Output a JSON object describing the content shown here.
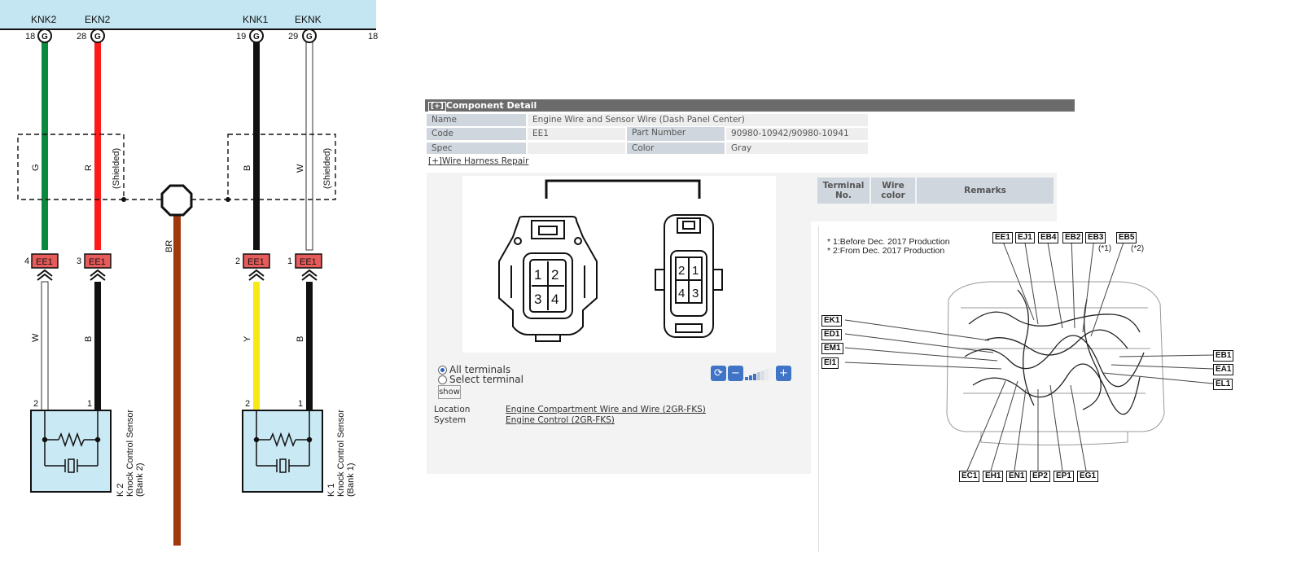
{
  "schematic": {
    "top_pins": [
      {
        "name": "KNK2",
        "num": "18",
        "type": "G"
      },
      {
        "name": "EKN2",
        "num": "28",
        "type": "G"
      },
      {
        "name": "KNK1",
        "num": "19",
        "type": "G"
      },
      {
        "name": "EKNK",
        "num": "29",
        "type": "G"
      },
      {
        "num": "18"
      }
    ],
    "wires_upper": [
      "G",
      "R",
      "B",
      "W"
    ],
    "shielded": [
      "(Shielded)",
      "(Shielded)"
    ],
    "ground_wire": "BR",
    "connectors": [
      {
        "pin": "4",
        "name": "EE1"
      },
      {
        "pin": "3",
        "name": "EE1"
      },
      {
        "pin": "2",
        "name": "EE1"
      },
      {
        "pin": "1",
        "name": "EE1"
      }
    ],
    "wires_lower": [
      "W",
      "B",
      "Y",
      "B"
    ],
    "sensor_pins": [
      "2",
      "1",
      "2",
      "1"
    ],
    "sensors": [
      {
        "id": "K 2",
        "line1": "Knock Control Sensor",
        "line2": "(Bank 2)"
      },
      {
        "id": "K 1",
        "line1": "Knock Control Sensor",
        "line2": "(Bank 1)"
      }
    ],
    "colors": {
      "green": "#0a8a3c",
      "red": "#ff1a1a",
      "black": "#111111",
      "yellow": "#f7ea14",
      "brown": "#a0390e",
      "connector": "#e85b5b",
      "sensor": "#c9e9f4",
      "header": "#c4e6f2"
    }
  },
  "detail": {
    "title": "Component Detail",
    "toggle": "[+]",
    "name_label": "Name",
    "name_value": "Engine Wire and Sensor Wire (Dash Panel Center)",
    "code_label": "Code",
    "code_value": "EE1",
    "part_label": "Part Number",
    "part_value": "90980-10942/90980-10941",
    "spec_label": "Spec",
    "spec_value": "",
    "color_label": "Color",
    "color_value": "Gray",
    "repair_link": "[+]Wire Harness Repair",
    "connector_left": [
      "1",
      "2",
      "3",
      "4"
    ],
    "connector_right": [
      "2",
      "1",
      "4",
      "3"
    ],
    "table_headers": [
      "Terminal No.",
      "Wire color",
      "Remarks"
    ],
    "radio_all": "All terminals",
    "radio_select": "Select terminal",
    "show_button": "show",
    "location_label": "Location",
    "location_value": "Engine Compartment  Wire and Wire (2GR-FKS)",
    "system_label": "System",
    "system_value": "Engine Control (2GR-FKS)",
    "accent": "#3f74c6"
  },
  "location_map": {
    "notes": [
      "* 1:Before Dec. 2017 Production",
      "* 2:From Dec. 2017 Production"
    ],
    "top_tags": [
      "EE1",
      "EJ1",
      "EB4",
      "EB2",
      "EB3",
      "EB5"
    ],
    "top_notes": [
      "(*1)",
      "(*2)"
    ],
    "left_tags": [
      "EK1",
      "ED1",
      "EM1",
      "EI1"
    ],
    "right_tags": [
      "EB1",
      "EA1",
      "EL1"
    ],
    "bottom_tags": [
      "EC1",
      "EH1",
      "EN1",
      "EP2",
      "EP1",
      "EG1"
    ]
  }
}
